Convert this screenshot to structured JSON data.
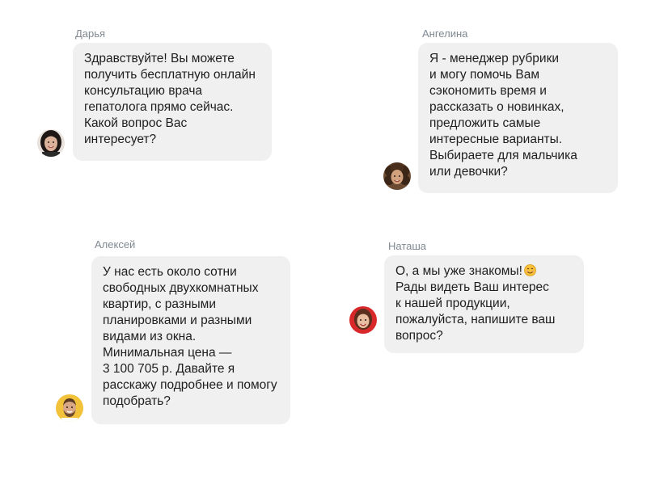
{
  "chats": [
    {
      "sender": "Дарья",
      "avatar_icon": "woman-dark-hair-avatar-icon",
      "text": "Здравствуйте! Вы можете\nполучить бесплатную онлайн\nконсультацию врача\nгепатолога прямо сейчас.\nКакой вопрос Вас\nинтересует?"
    },
    {
      "sender": "Ангелина",
      "avatar_icon": "woman-curly-hair-avatar-icon",
      "text": "Я - менеджер рубрики\nи могу помочь Вам\nсэкономить время и\nрассказать о новинках,\nпредложить самые\nинтересные варианты.\nВыбираете для мальчика\nили девочки?"
    },
    {
      "sender": "Алексей",
      "avatar_icon": "man-beard-avatar-icon",
      "text": "У нас есть около сотни\nсвободных двухкомнатных\nквартир, с разными\nпланировками и разными\nвидами из окна.\nМинимальная цена —\n3 100 705 р. Давайте я\nрасскажу подробнее и помогу\nподобрать?"
    },
    {
      "sender": "Наташа",
      "avatar_icon": "woman-red-background-avatar-icon",
      "text_line1": "О, а мы уже знакомы!",
      "emoji_icon": "smiling-face-emoji-icon",
      "text_rest": "Рады видеть Ваш интерес\nк нашей продукции,\nпожалуйста, напишите ваш\nвопрос?"
    }
  ],
  "colors": {
    "bubble": "#f0f0f0",
    "name": "#7f8891",
    "text": "#1e1e1e"
  }
}
